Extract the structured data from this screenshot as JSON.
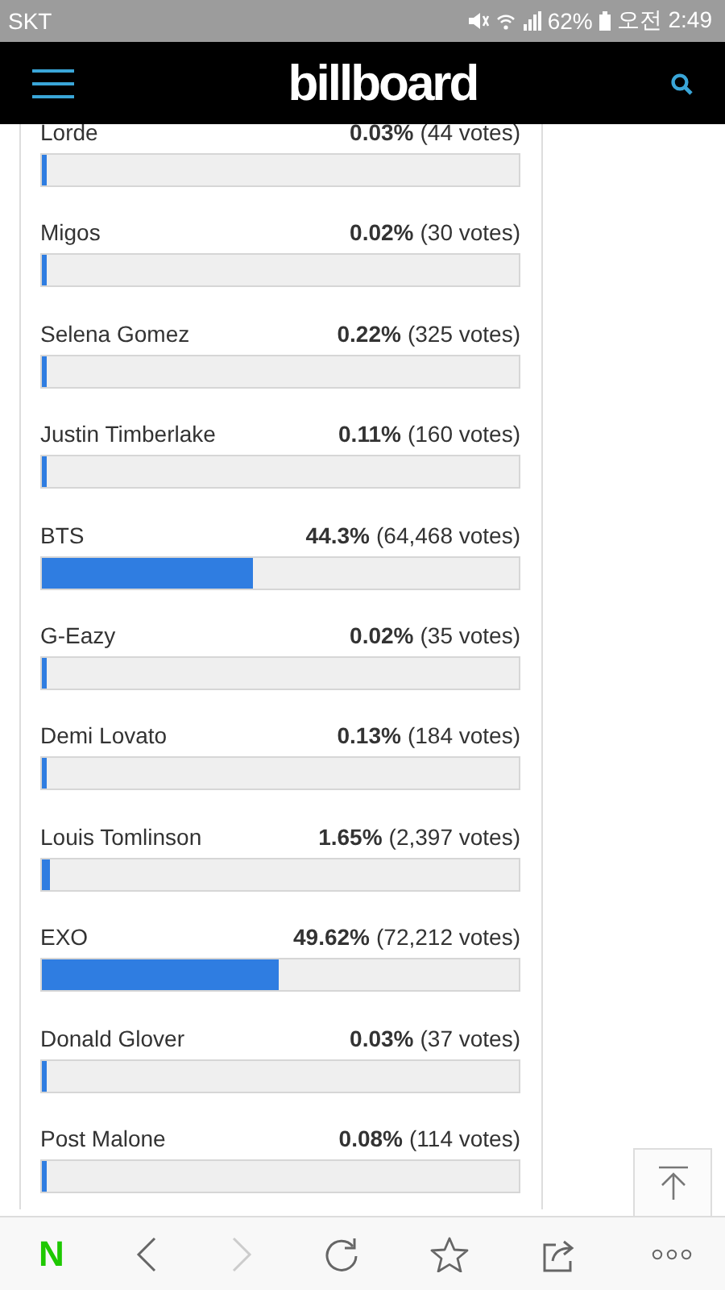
{
  "status_bar": {
    "carrier": "SKT",
    "battery": "62%",
    "time": "오전 2:49"
  },
  "header": {
    "logo": "billboard"
  },
  "poll": [
    {
      "name": "Lorde",
      "percent": "0.03%",
      "votes": "(44 votes)",
      "level": 0.0003
    },
    {
      "name": "Migos",
      "percent": "0.02%",
      "votes": "(30 votes)",
      "level": 0.0002
    },
    {
      "name": "Selena Gomez",
      "percent": "0.22%",
      "votes": "(325 votes)",
      "level": 0.0022
    },
    {
      "name": "Justin Timberlake",
      "percent": "0.11%",
      "votes": "(160 votes)",
      "level": 0.0011
    },
    {
      "name": "BTS",
      "percent": "44.3%",
      "votes": "(64,468 votes)",
      "level": 0.443
    },
    {
      "name": "G-Eazy",
      "percent": "0.02%",
      "votes": "(35 votes)",
      "level": 0.0002
    },
    {
      "name": "Demi Lovato",
      "percent": "0.13%",
      "votes": "(184 votes)",
      "level": 0.0013
    },
    {
      "name": "Louis Tomlinson",
      "percent": "1.65%",
      "votes": "(2,397 votes)",
      "level": 0.0165
    },
    {
      "name": "EXO",
      "percent": "49.62%",
      "votes": "(72,212 votes)",
      "level": 0.4962
    },
    {
      "name": "Donald Glover",
      "percent": "0.03%",
      "votes": "(37 votes)",
      "level": 0.0003
    },
    {
      "name": "Post Malone",
      "percent": "0.08%",
      "votes": "(114 votes)",
      "level": 0.0008
    }
  ],
  "browser_toolbar": {
    "home_logo": "N",
    "back_disabled": false,
    "forward_disabled": true
  }
}
